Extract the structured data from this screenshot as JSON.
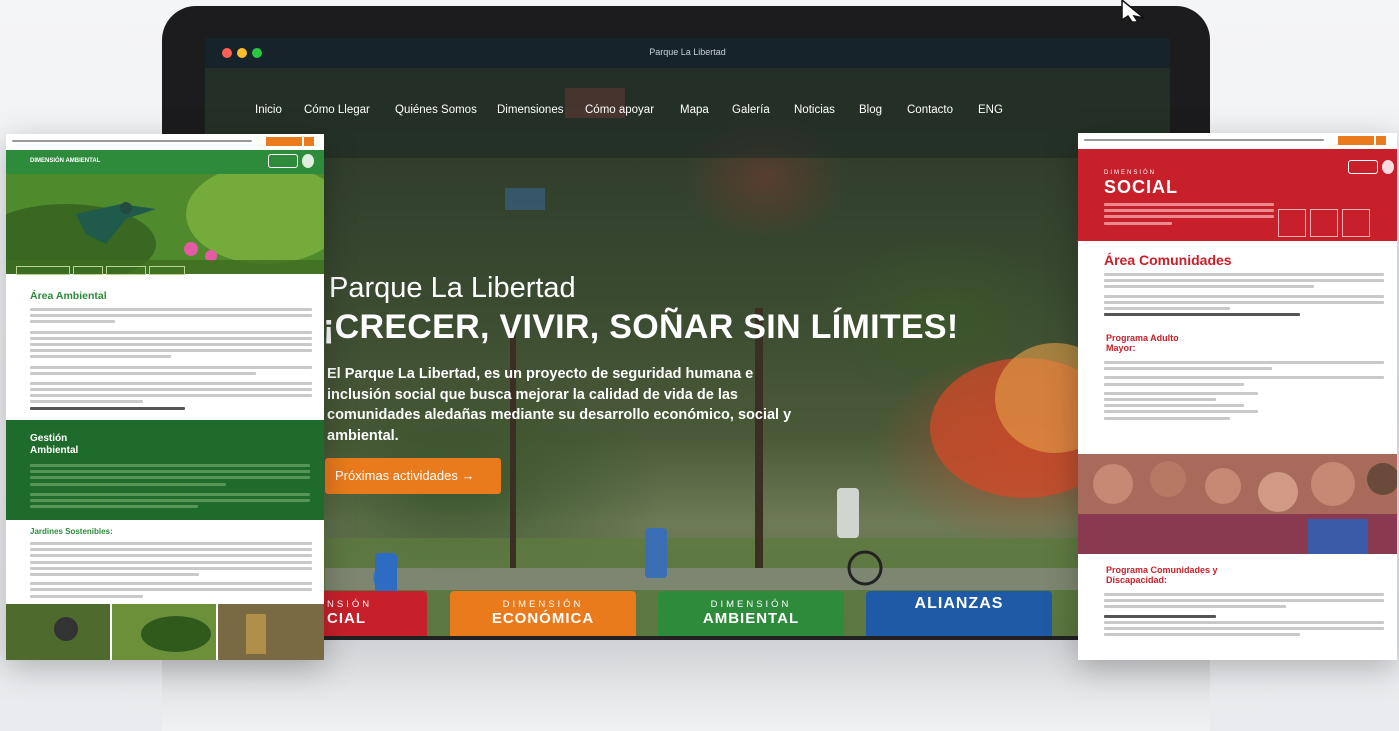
{
  "window": {
    "title": "Parque La Libertad"
  },
  "nav": {
    "items": [
      "Inicio",
      "Cómo Llegar",
      "Quiénes Somos",
      "Dimensiones",
      "Cómo apoyar",
      "Mapa",
      "Galería",
      "Noticias",
      "Blog",
      "Contacto",
      "ENG"
    ]
  },
  "hero": {
    "subtitle": "Parque La Libertad",
    "title": "¡CRECER, VIVIR, SOÑAR SIN LÍMITES!",
    "description": "El Parque La Libertad, es un proyecto de seguridad humana e inclusión social que busca mejorar la calidad de vida de las comunidades aledañas mediante su desarrollo económico, social y ambiental.",
    "cta_label": "Próximas actividades →"
  },
  "tiles": [
    {
      "line1": "NSIÓN",
      "line2": "CIAL"
    },
    {
      "line1": "DIMENSIÓN",
      "line2": "ECONÓMICA"
    },
    {
      "line1": "DIMENSIÓN",
      "line2": "AMBIENTAL"
    },
    {
      "line1": "",
      "line2": "ALIANZAS"
    }
  ],
  "left_page": {
    "header": "DIMENSIÓN AMBIENTAL",
    "section1": "Área Ambiental",
    "section2": "Gestión Ambiental",
    "section3": "Jardines Sostenibles:"
  },
  "right_page": {
    "header_small": "DIMENSIÓN",
    "header_big": "SOCIAL",
    "section1": "Área Comunidades",
    "program1": "Programa Adulto Mayor:",
    "program2": "Programa Comunidades y Discapacidad:"
  },
  "colors": {
    "social": "#c8202a",
    "economica": "#e97b1c",
    "ambiental": "#2e8b3b",
    "alianzas": "#1f5aa6",
    "dark_green": "#1f6b2c"
  }
}
